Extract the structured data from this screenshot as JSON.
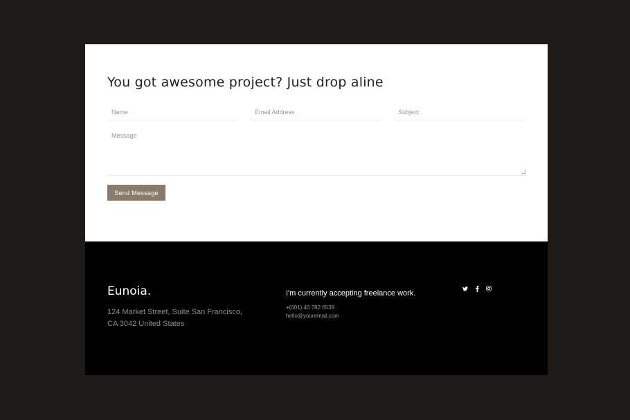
{
  "contact": {
    "title": "You got awesome project? Just drop aline",
    "name_placeholder": "Name",
    "email_placeholder": "Email Address",
    "subject_placeholder": "Subject",
    "message_placeholder": "Message",
    "send_label": "Send Message"
  },
  "footer": {
    "brand": "Eunoia.",
    "address_line1": "124 Market Street, Suite San Francisco,",
    "address_line2": "CA 3042 United States",
    "freelance_text": "I'm currently accepting freelance work.",
    "phone": "+(001) 40 782 6539",
    "email": "hello@youremail.com",
    "socials": [
      "twitter-icon",
      "facebook-icon",
      "instagram-icon"
    ]
  },
  "colors": {
    "page_bg": "#1c1b1a",
    "button_bg": "#8a7b6c",
    "footer_bg": "#000000"
  }
}
